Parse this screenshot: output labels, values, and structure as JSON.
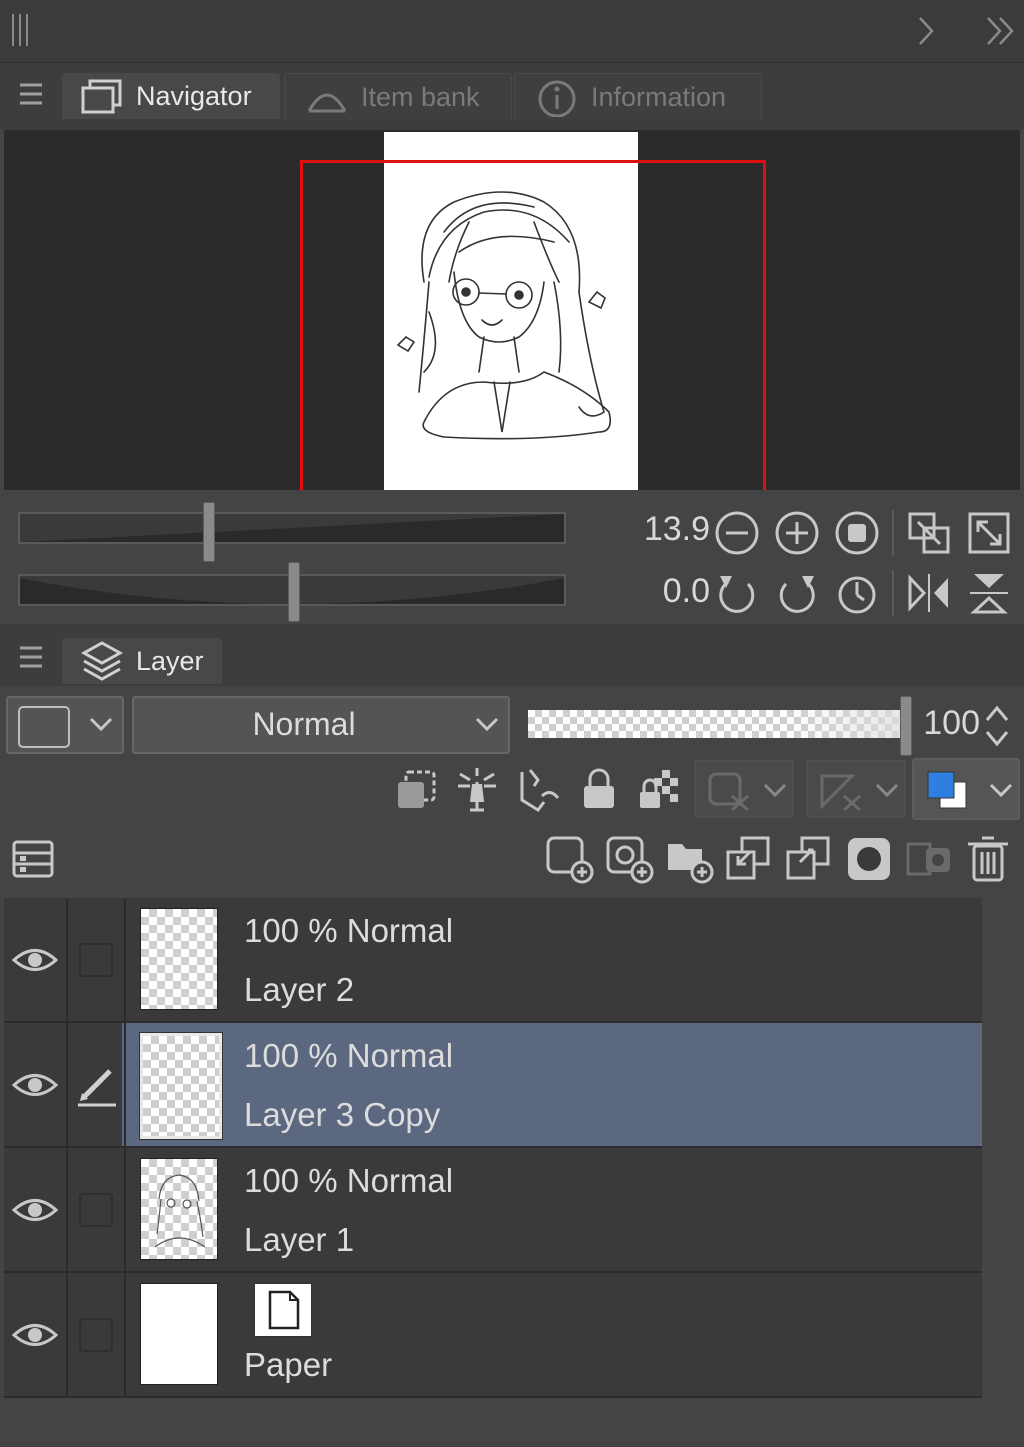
{
  "navigator_panel": {
    "tabs": [
      {
        "label": "Navigator",
        "icon": "navigator-icon",
        "active": true
      },
      {
        "label": "Item bank",
        "icon": "item-bank-icon",
        "active": false
      },
      {
        "label": "Information",
        "icon": "information-icon",
        "active": false
      }
    ],
    "zoom_value": "13.9",
    "rotation_value": "0.0",
    "view_frame_color": "#e01010"
  },
  "layer_panel": {
    "tab_label": "Layer",
    "blend_mode": "Normal",
    "opacity_value": "100",
    "layers": [
      {
        "status": "100 % Normal",
        "name": "Layer 2",
        "selected": false,
        "editing": false
      },
      {
        "status": "100 % Normal",
        "name": "Layer 3 Copy",
        "selected": true,
        "editing": true
      },
      {
        "status": "100 % Normal",
        "name": "Layer 1",
        "selected": false,
        "editing": false
      },
      {
        "status": "",
        "name": "Paper",
        "selected": false,
        "editing": false
      }
    ],
    "selection_color": "#5b6880",
    "accent_blue": "#2f7fe0"
  }
}
